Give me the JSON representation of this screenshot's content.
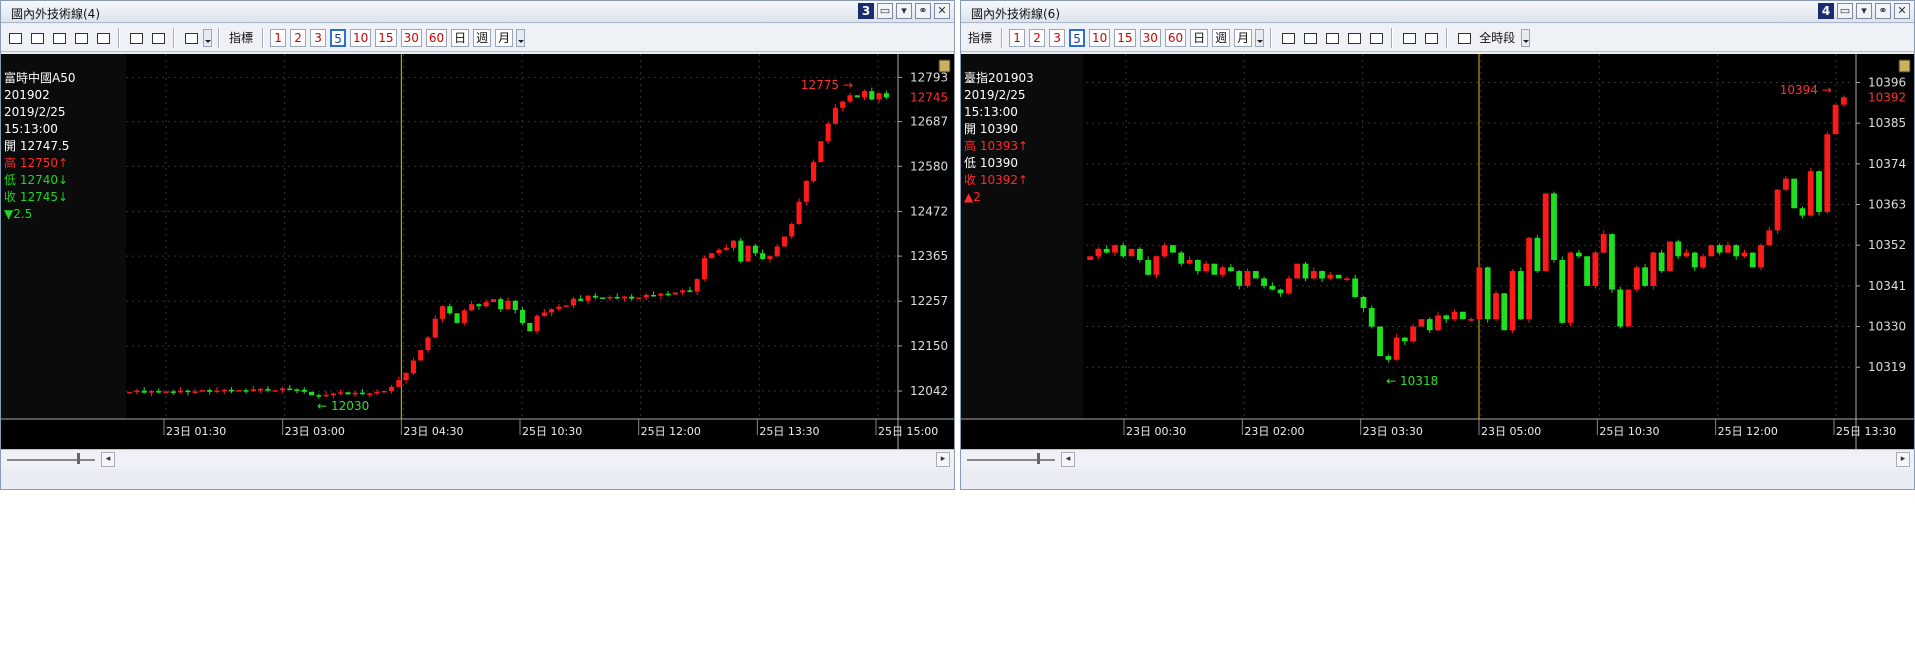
{
  "panels": [
    {
      "window_title": "國內外技術線(4)",
      "window_number": "3",
      "toolbar": {
        "indicator_label": "指標",
        "periods": [
          "1",
          "2",
          "3",
          "5",
          "10",
          "15",
          "30",
          "60",
          "日",
          "週",
          "月"
        ],
        "active_period": "5",
        "range_label": ""
      },
      "info": {
        "name": "富時中國A50",
        "contract": "201902",
        "date": "2019/2/25",
        "time": "15:13:00",
        "open": "開 12747.5",
        "high": "高 12750↑",
        "low": "低 12740↓",
        "close": "收 12745↓",
        "change": "▼2.5",
        "high_dir": "up",
        "low_dir": "down",
        "close_dir": "down",
        "change_dir": "down"
      },
      "chart_data": {
        "type": "candlestick",
        "y_ticks": [
          "12793",
          "12687",
          "12580",
          "12472",
          "12365",
          "12257",
          "12150",
          "12042"
        ],
        "ylim": [
          11975,
          12825
        ],
        "x_ticks": [
          "23日 01:30",
          "23日 03:00",
          "23日 04:30",
          "25日 10:30",
          "25日 12:00",
          "25日 13:30",
          "25日 15:00"
        ],
        "session_marker_label": "23日 04:30",
        "current_price": "12745",
        "high_label": "12775 →",
        "low_label": "← 12030",
        "high_value": 12775,
        "low_value": 12030,
        "closes": [
          12040,
          12043,
          12038,
          12042,
          12040,
          12041,
          12039,
          12043,
          12040,
          12041,
          12044,
          12040,
          12043,
          12045,
          12041,
          12044,
          12042,
          12046,
          12047,
          12043,
          12044,
          12048,
          12046,
          12045,
          12040,
          12032,
          12030,
          12033,
          12036,
          12039,
          12034,
          12038,
          12035,
          12036,
          12040,
          12042,
          12052,
          12068,
          12085,
          12115,
          12140,
          12170,
          12215,
          12245,
          12228,
          12205,
          12235,
          12250,
          12245,
          12255,
          12262,
          12238,
          12258,
          12236,
          12205,
          12185,
          12222,
          12230,
          12238,
          12244,
          12247,
          12263,
          12258,
          12270,
          12266,
          12265,
          12267,
          12264,
          12268,
          12263,
          12266,
          12272,
          12270,
          12275,
          12273,
          12278,
          12283,
          12280,
          12310,
          12360,
          12372,
          12380,
          12385,
          12402,
          12352,
          12390,
          12372,
          12358,
          12365,
          12388,
          12412,
          12442,
          12495,
          12545,
          12590,
          12640,
          12682,
          12720,
          12735,
          12750,
          12745,
          12760,
          12740,
          12755,
          12745
        ],
        "opens": [
          12038,
          12040,
          12043,
          12038,
          12042,
          12040,
          12041,
          12039,
          12043,
          12040,
          12041,
          12044,
          12040,
          12043,
          12045,
          12041,
          12044,
          12042,
          12046,
          12047,
          12043,
          12044,
          12048,
          12046,
          12045,
          12040,
          12032,
          12030,
          12033,
          12036,
          12039,
          12034,
          12038,
          12035,
          12036,
          12040,
          12042,
          12052,
          12068,
          12085,
          12115,
          12140,
          12170,
          12215,
          12245,
          12228,
          12205,
          12235,
          12250,
          12245,
          12255,
          12262,
          12238,
          12258,
          12236,
          12205,
          12185,
          12222,
          12230,
          12238,
          12244,
          12247,
          12263,
          12258,
          12270,
          12266,
          12265,
          12267,
          12264,
          12268,
          12263,
          12266,
          12272,
          12270,
          12275,
          12273,
          12278,
          12283,
          12280,
          12310,
          12360,
          12372,
          12380,
          12385,
          12402,
          12352,
          12390,
          12372,
          12358,
          12365,
          12388,
          12412,
          12442,
          12495,
          12545,
          12590,
          12640,
          12682,
          12720,
          12735,
          12750,
          12745,
          12760,
          12740,
          12755
        ]
      }
    },
    {
      "window_title": "國內外技術線(6)",
      "window_number": "4",
      "toolbar": {
        "indicator_label": "指標",
        "periods": [
          "1",
          "2",
          "3",
          "5",
          "10",
          "15",
          "30",
          "60",
          "日",
          "週",
          "月"
        ],
        "active_period": "5",
        "range_label": "全時段"
      },
      "info": {
        "name": "臺指201903",
        "contract": "",
        "date": "2019/2/25",
        "time": "15:13:00",
        "open": "開 10390",
        "high": "高 10393↑",
        "low": "低 10390",
        "close": "收 10392↑",
        "change": "▲2",
        "high_dir": "up",
        "low_dir": "neutral",
        "close_dir": "up",
        "change_dir": "up"
      },
      "chart_data": {
        "type": "candlestick",
        "y_ticks": [
          "10396",
          "10392",
          "10385",
          "10374",
          "10363",
          "10352",
          "10341",
          "10330",
          "10319"
        ],
        "ylim": [
          10305,
          10401
        ],
        "x_ticks": [
          "23日 00:30",
          "23日 02:00",
          "23日 03:30",
          "23日 05:00",
          "25日 10:30",
          "25日 12:00",
          "25日 13:30"
        ],
        "session_marker_label": "23日 05:00",
        "current_price": "10392",
        "high_label": "10394 →",
        "low_label": "← 10318",
        "high_value": 10394,
        "low_value": 10318,
        "closes": [
          10349,
          10351,
          10350,
          10352,
          10349,
          10351,
          10348,
          10344,
          10349,
          10352,
          10350,
          10347,
          10348,
          10345,
          10347,
          10344,
          10346,
          10345,
          10341,
          10345,
          10343,
          10341,
          10340,
          10339,
          10343,
          10347,
          10343,
          10345,
          10343,
          10344,
          10343,
          10343,
          10338,
          10335,
          10330,
          10322,
          10321,
          10327,
          10326,
          10330,
          10332,
          10329,
          10333,
          10332,
          10334,
          10332,
          10332,
          10346,
          10332,
          10339,
          10329,
          10345,
          10332,
          10354,
          10345,
          10366,
          10348,
          10331,
          10350,
          10349,
          10341,
          10350,
          10355,
          10340,
          10330,
          10340,
          10346,
          10341,
          10350,
          10345,
          10353,
          10349,
          10350,
          10346,
          10349,
          10352,
          10350,
          10352,
          10349,
          10350,
          10346,
          10352,
          10356,
          10367,
          10370,
          10362,
          10360,
          10372,
          10361,
          10382,
          10390,
          10392
        ],
        "opens": [
          10348,
          10349,
          10351,
          10350,
          10352,
          10349,
          10351,
          10348,
          10344,
          10349,
          10352,
          10350,
          10347,
          10348,
          10345,
          10347,
          10344,
          10346,
          10345,
          10341,
          10345,
          10343,
          10341,
          10340,
          10339,
          10343,
          10347,
          10343,
          10345,
          10343,
          10344,
          10343,
          10343,
          10338,
          10335,
          10330,
          10322,
          10321,
          10327,
          10326,
          10330,
          10332,
          10329,
          10333,
          10332,
          10334,
          10332,
          10332,
          10346,
          10332,
          10339,
          10329,
          10345,
          10332,
          10354,
          10345,
          10366,
          10348,
          10331,
          10350,
          10349,
          10341,
          10350,
          10355,
          10340,
          10330,
          10340,
          10346,
          10341,
          10350,
          10345,
          10353,
          10349,
          10350,
          10346,
          10349,
          10352,
          10350,
          10352,
          10349,
          10350,
          10346,
          10352,
          10356,
          10367,
          10370,
          10362,
          10360,
          10372,
          10361,
          10382,
          10390
        ]
      }
    }
  ]
}
